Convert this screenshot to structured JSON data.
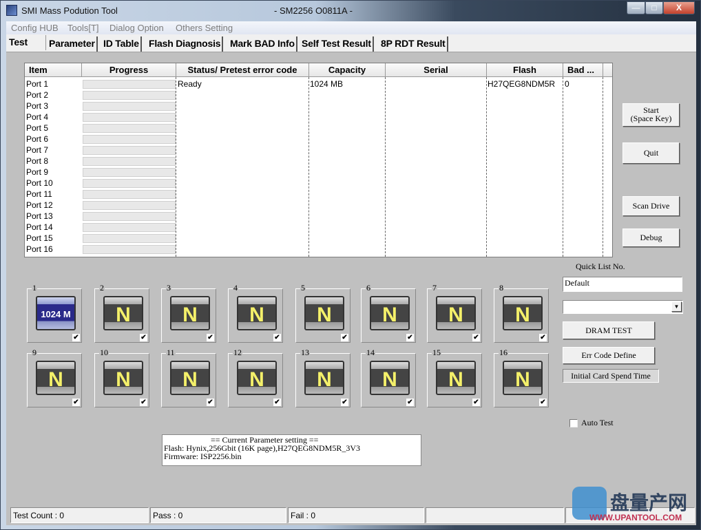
{
  "window": {
    "title": "SMI Mass Podution Tool",
    "subtitle": "- SM2256 O0811A -",
    "controls": {
      "minimize": "—",
      "maximize": "□",
      "close": "X"
    }
  },
  "menu": [
    "Config HUB",
    "Tools[T]",
    "Dialog Option",
    "Others Setting"
  ],
  "tabs": [
    {
      "label": "Test",
      "active": true
    },
    {
      "label": "Parameter"
    },
    {
      "label": "ID Table"
    },
    {
      "label": "Flash Diagnosis"
    },
    {
      "label": "Mark BAD Info"
    },
    {
      "label": "Self Test Result"
    },
    {
      "label": "8P RDT Result"
    }
  ],
  "grid": {
    "columns": [
      "Item",
      "Progress",
      "Status/ Pretest error code",
      "Capacity",
      "Serial",
      "Flash",
      "Bad ..."
    ],
    "rows": [
      {
        "item": "Port 1",
        "progress": 0,
        "status": "Ready",
        "capacity": "1024 MB",
        "serial": "",
        "flash": "H27QEG8NDM5R",
        "bad": "0"
      },
      {
        "item": "Port 2"
      },
      {
        "item": "Port 3"
      },
      {
        "item": "Port 4"
      },
      {
        "item": "Port 5"
      },
      {
        "item": "Port 6"
      },
      {
        "item": "Port 7"
      },
      {
        "item": "Port 8"
      },
      {
        "item": "Port 9"
      },
      {
        "item": "Port 10"
      },
      {
        "item": "Port 11"
      },
      {
        "item": "Port 12"
      },
      {
        "item": "Port 13"
      },
      {
        "item": "Port 14"
      },
      {
        "item": "Port 15"
      },
      {
        "item": "Port 16"
      }
    ]
  },
  "buttons": {
    "start": [
      "Start",
      "(Space Key)"
    ],
    "quit": "Quit",
    "scan_drive": "Scan Drive",
    "debug": "Debug",
    "dram_test": "DRAM TEST",
    "err_code": "Err Code Define",
    "init_card": "Initial Card Spend Time"
  },
  "quick_list": {
    "label": "Quick List No.",
    "value": "Default",
    "select_value": ""
  },
  "auto_test": {
    "label": "Auto Test",
    "checked": false
  },
  "ports": [
    {
      "label": "1",
      "display": "1024 M",
      "active": true,
      "checked": true
    },
    {
      "label": "2",
      "display": "N",
      "checked": true
    },
    {
      "label": "3",
      "display": "N",
      "checked": true
    },
    {
      "label": "4",
      "display": "N",
      "checked": true
    },
    {
      "label": "5",
      "display": "N",
      "checked": true
    },
    {
      "label": "6",
      "display": "N",
      "checked": true
    },
    {
      "label": "7",
      "display": "N",
      "checked": true
    },
    {
      "label": "8",
      "display": "N",
      "checked": true
    },
    {
      "label": "9",
      "display": "N",
      "checked": true
    },
    {
      "label": "10",
      "display": "N",
      "checked": true
    },
    {
      "label": "11",
      "display": "N",
      "checked": true
    },
    {
      "label": "12",
      "display": "N",
      "checked": true
    },
    {
      "label": "13",
      "display": "N",
      "checked": true
    },
    {
      "label": "14",
      "display": "N",
      "checked": true
    },
    {
      "label": "15",
      "display": "N",
      "checked": true
    },
    {
      "label": "16",
      "display": "N",
      "checked": true
    }
  ],
  "parameter": {
    "heading": "== Current Parameter setting ==",
    "flash": "Flash:   Hynix,256Gbit (16K page),H27QEG8NDM5R_3V3",
    "firmware": "Firmware:   ISP2256.bin"
  },
  "status": {
    "test_count": "Test Count : 0",
    "pass": "Pass : 0",
    "fail": "Fail : 0",
    "s4": "",
    "s5": ""
  },
  "watermark": {
    "text": "盘量产网",
    "url": "WWW.UPANTOOL.COM"
  }
}
